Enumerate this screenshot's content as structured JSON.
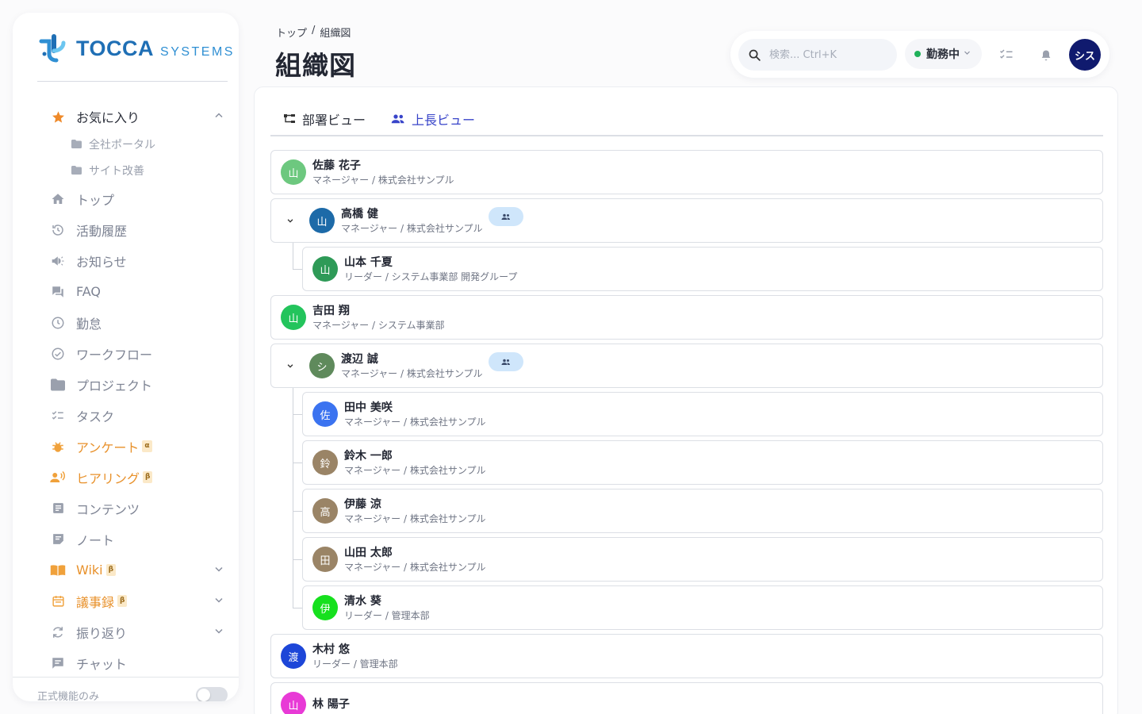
{
  "brand": {
    "name_main": "TOCCA",
    "name_sub": "SYSTEMS"
  },
  "sidebar": {
    "favorites": {
      "label": "お気に入り",
      "items": [
        {
          "label": "全社ポータル"
        },
        {
          "label": "サイト改善"
        }
      ]
    },
    "items": [
      {
        "label": "トップ",
        "icon": "home-icon"
      },
      {
        "label": "活動履歴",
        "icon": "history-icon"
      },
      {
        "label": "お知らせ",
        "icon": "megaphone-icon"
      },
      {
        "label": "FAQ",
        "icon": "chat-bubbles-icon"
      },
      {
        "label": "勤怠",
        "icon": "clock-icon"
      },
      {
        "label": "ワークフロー",
        "icon": "check-circle-icon"
      },
      {
        "label": "プロジェクト",
        "icon": "folder-icon"
      },
      {
        "label": "タスク",
        "icon": "task-list-icon"
      },
      {
        "label": "アンケート",
        "icon": "bug-icon",
        "badge": "α"
      },
      {
        "label": "ヒアリング",
        "icon": "voice-person-icon",
        "badge": "β"
      },
      {
        "label": "コンテンツ",
        "icon": "article-icon"
      },
      {
        "label": "ノート",
        "icon": "note-icon"
      },
      {
        "label": "Wiki",
        "icon": "book-icon",
        "badge": "β"
      },
      {
        "label": "議事録",
        "icon": "calendar-icon",
        "badge": "β"
      },
      {
        "label": "振り返り",
        "icon": "refresh-icon"
      },
      {
        "label": "チャット",
        "icon": "chat-icon"
      }
    ],
    "footer": {
      "label": "正式機能のみ",
      "toggle_on": false
    }
  },
  "header": {
    "breadcrumb": {
      "home": "トップ",
      "sep": "/",
      "current": "組織図"
    },
    "title": "組織図",
    "search_placeholder": "検索... Ctrl+K",
    "status": "勤務中",
    "user_initials": "シス"
  },
  "tabs": [
    {
      "label": "部署ビュー",
      "active": false
    },
    {
      "label": "上長ビュー",
      "active": true
    }
  ],
  "org": [
    {
      "name": "佐藤 花子",
      "role": "マネージャー / 株式会社サンプル",
      "initial": "山",
      "color": "#6dc87f",
      "level": 0,
      "expandable": false
    },
    {
      "name": "高橋 健",
      "role": "マネージャー / 株式会社サンプル",
      "initial": "山",
      "color": "#1d6aa8",
      "level": 0,
      "expandable": true,
      "team_chip": true
    },
    {
      "name": "山本 千夏",
      "role": "リーダー / システム事業部 開発グループ",
      "initial": "山",
      "color": "#2e9a57",
      "level": 1
    },
    {
      "name": "吉田 翔",
      "role": "マネージャー / システム事業部",
      "initial": "山",
      "color": "#23c45c",
      "level": 0,
      "expandable": false
    },
    {
      "name": "渡辺 誠",
      "role": "マネージャー / 株式会社サンプル",
      "initial": "シ",
      "color": "#5f8a5c",
      "level": 0,
      "expandable": true,
      "team_chip": true
    },
    {
      "name": "田中 美咲",
      "role": "マネージャー / 株式会社サンプル",
      "initial": "佐",
      "color": "#3b73f0",
      "level": 1
    },
    {
      "name": "鈴木 一郎",
      "role": "マネージャー / 株式会社サンプル",
      "initial": "鈴",
      "color": "#9a8466",
      "level": 1
    },
    {
      "name": "伊藤 涼",
      "role": "マネージャー / 株式会社サンプル",
      "initial": "高",
      "color": "#9a8466",
      "level": 1
    },
    {
      "name": "山田 太郎",
      "role": "マネージャー / 株式会社サンプル",
      "initial": "田",
      "color": "#9a8466",
      "level": 1
    },
    {
      "name": "清水 葵",
      "role": "リーダー / 管理本部",
      "initial": "伊",
      "color": "#16e01e",
      "level": 1
    },
    {
      "name": "木村 悠",
      "role": "リーダー / 管理本部",
      "initial": "渡",
      "color": "#1d46d8",
      "level": 0,
      "expandable": false
    },
    {
      "name": "林 陽子",
      "role": "",
      "initial": "山",
      "color": "#e83ad6",
      "level": 0,
      "expandable": false
    }
  ]
}
